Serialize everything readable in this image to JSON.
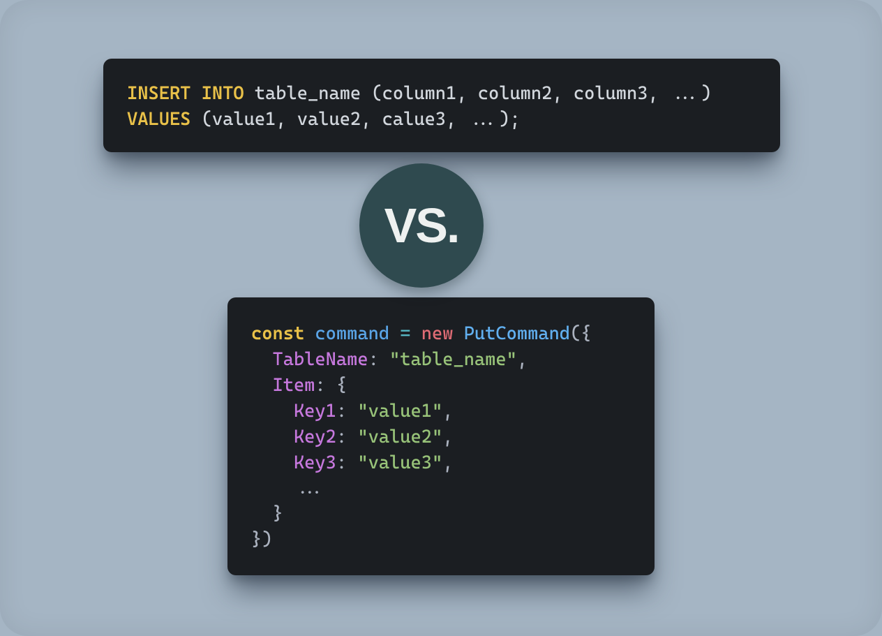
{
  "badge": {
    "label": "VS."
  },
  "sql": {
    "kw_insert": "INSERT",
    "kw_into": "INTO",
    "table": "table_name",
    "cols_open": "(column1, column2, column3, ...)",
    "kw_values": "VALUES",
    "vals": "(value1, value2, calue3, ...);"
  },
  "js": {
    "kw_const": "const",
    "ident_command": "command",
    "op_eq": "=",
    "kw_new": "new",
    "class_put": "PutCommand",
    "open_call": "({",
    "prop_table": "TableName",
    "str_table": "\"table_name\"",
    "prop_item": "Item",
    "open_obj": "{",
    "prop_key1": "Key1",
    "str_val1": "\"value1\"",
    "prop_key2": "Key2",
    "str_val2": "\"value2\"",
    "prop_key3": "Key3",
    "str_val3": "\"value3\"",
    "ellipsis": "...",
    "close_obj": "}",
    "close_call": "})"
  }
}
